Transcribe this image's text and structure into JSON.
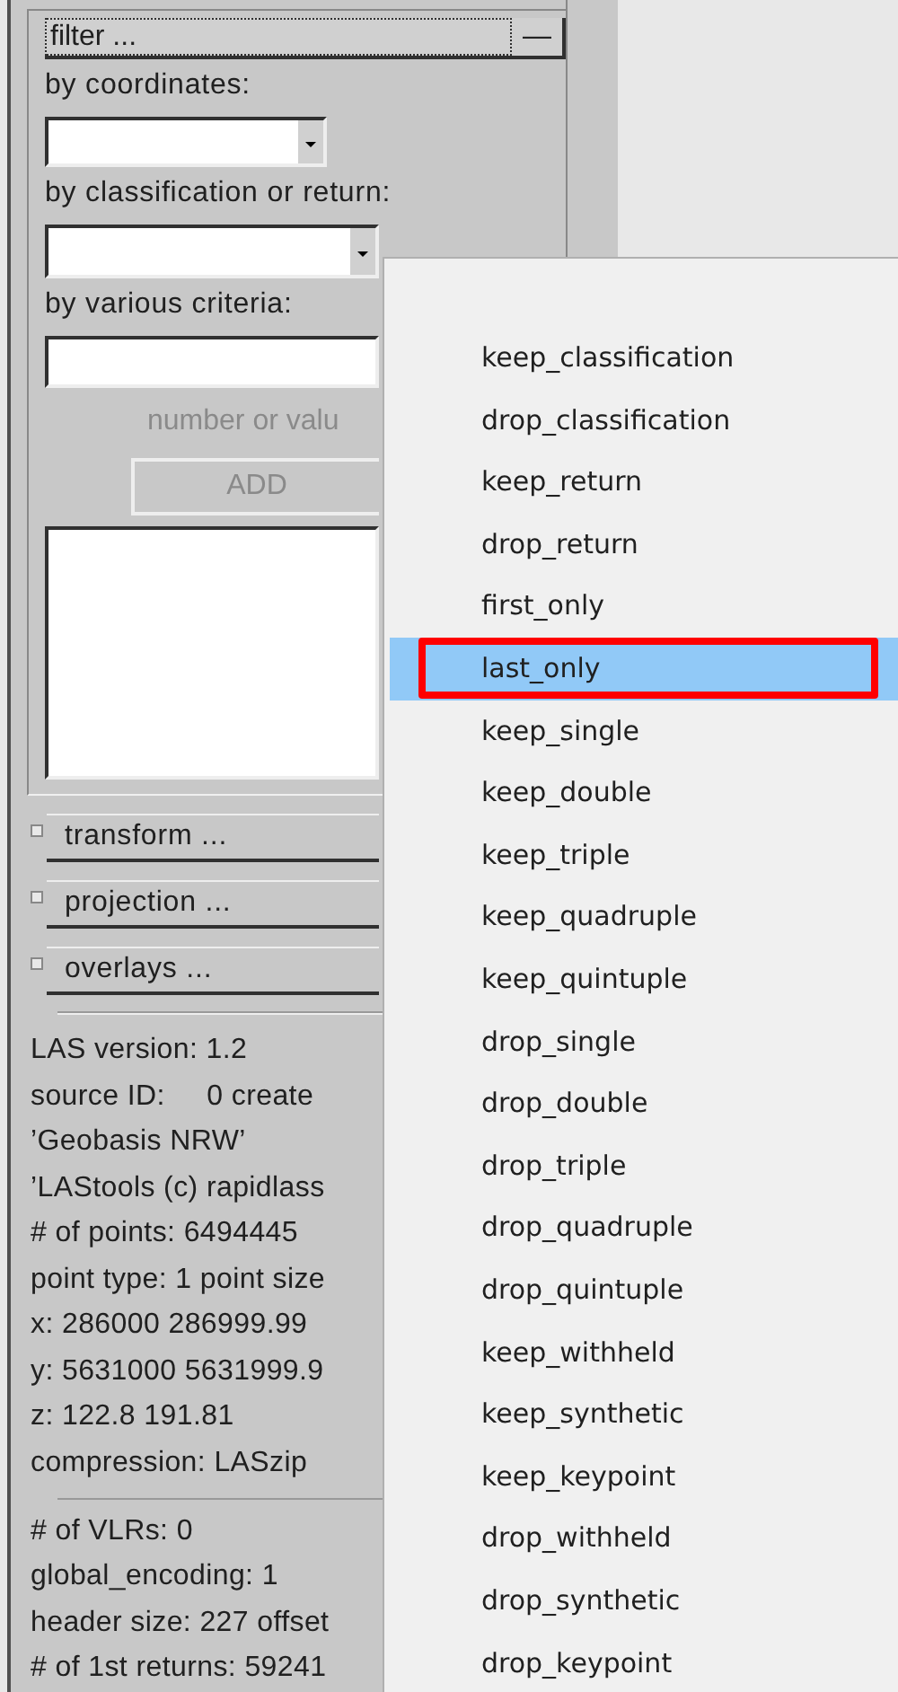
{
  "filter": {
    "title": "filter ...",
    "collapse_button": "—",
    "coordinates_label": "by coordinates:",
    "classification_label": "by classification or return:",
    "criteria_label": "by various criteria:",
    "value_hint": "number or valu",
    "add_button": {
      "label": "ADD",
      "disabled": true
    }
  },
  "sections": [
    {
      "label": "transform ...",
      "expanded": false
    },
    {
      "label": "projection ...",
      "expanded": false
    },
    {
      "label": "overlays ...",
      "expanded": false
    }
  ],
  "header_info": [
    "LAS version: 1.2",
    "source ID:     0 create",
    "’Geobasis NRW’",
    "’LAStools (c) rapidlass",
    "# of points: 6494445",
    "point type: 1 point size",
    "x: 286000 286999.99",
    "y: 5631000 5631999.9",
    "z: 122.8 191.81",
    "compression: LASzip"
  ],
  "vlr_info": [
    "# of VLRs: 0",
    "global_encoding: 1",
    "header size: 227 offset",
    "# of 1st returns: 59241"
  ],
  "dropdown_menu": {
    "items": [
      {
        "label": "keep_classification",
        "selected": false
      },
      {
        "label": "drop_classification",
        "selected": false
      },
      {
        "label": "keep_return",
        "selected": false
      },
      {
        "label": "drop_return",
        "selected": false
      },
      {
        "label": "first_only",
        "selected": false
      },
      {
        "label": "last_only",
        "selected": true
      },
      {
        "label": "keep_single",
        "selected": false
      },
      {
        "label": "keep_double",
        "selected": false
      },
      {
        "label": "keep_triple",
        "selected": false
      },
      {
        "label": "keep_quadruple",
        "selected": false
      },
      {
        "label": "keep_quintuple",
        "selected": false
      },
      {
        "label": "drop_single",
        "selected": false
      },
      {
        "label": "drop_double",
        "selected": false
      },
      {
        "label": "drop_triple",
        "selected": false
      },
      {
        "label": "drop_quadruple",
        "selected": false
      },
      {
        "label": "drop_quintuple",
        "selected": false
      },
      {
        "label": "keep_withheld",
        "selected": false
      },
      {
        "label": "keep_synthetic",
        "selected": false
      },
      {
        "label": "keep_keypoint",
        "selected": false
      },
      {
        "label": "drop_withheld",
        "selected": false
      },
      {
        "label": "drop_synthetic",
        "selected": false
      },
      {
        "label": "drop_keypoint",
        "selected": false
      }
    ]
  }
}
